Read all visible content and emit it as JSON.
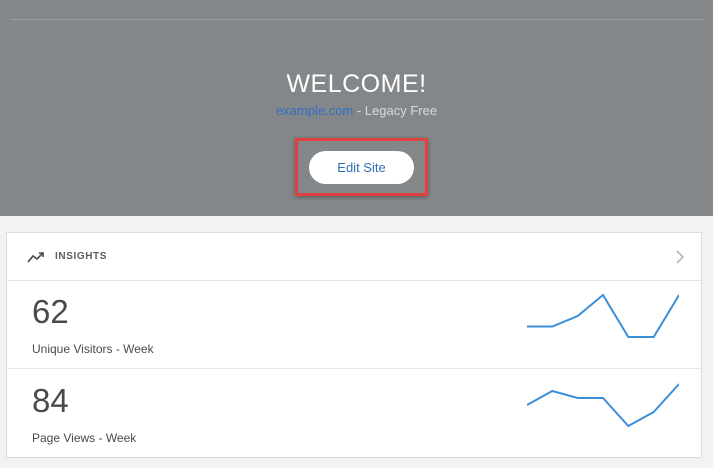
{
  "hero": {
    "title": "WELCOME!",
    "domain": "example.com",
    "separator": " - ",
    "plan": "Legacy Free",
    "edit_button": "Edit Site"
  },
  "insights": {
    "title": "INSIGHTS",
    "stats": [
      {
        "value": "62",
        "label": "Unique Visitors - Week",
        "trend": [
          2,
          2,
          3,
          5,
          1,
          1,
          5
        ]
      },
      {
        "value": "84",
        "label": "Page Views - Week",
        "trend": [
          3,
          4,
          3.5,
          3.5,
          1.5,
          2.5,
          4.5
        ]
      }
    ]
  },
  "colors": {
    "hero_bg": "#848789",
    "domain_link": "#2d6fc5",
    "highlight_box": "#e0403f",
    "sparkline": "#3b8fd9"
  },
  "icons": {
    "insights": "trend-up-icon",
    "expand": "chevron-right-icon"
  }
}
